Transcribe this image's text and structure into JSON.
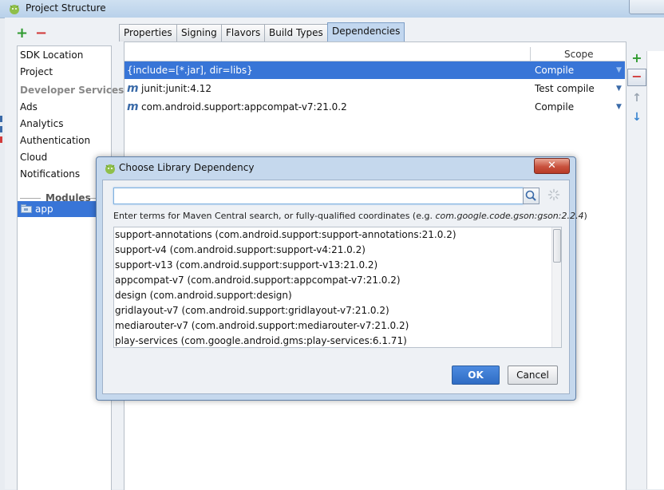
{
  "window": {
    "title": "Project Structure",
    "icon": "android-studio-icon"
  },
  "left_toolbar": {
    "add": "+",
    "remove": "−"
  },
  "sidebar": {
    "items": [
      {
        "label": "SDK Location"
      },
      {
        "label": "Project"
      },
      {
        "label": "Developer Services",
        "kind": "header"
      },
      {
        "label": "Ads"
      },
      {
        "label": "Analytics"
      },
      {
        "label": "Authentication"
      },
      {
        "label": "Cloud"
      },
      {
        "label": "Notifications"
      }
    ],
    "modules_label": "Modules",
    "modules": [
      {
        "label": "app",
        "selected": true
      }
    ]
  },
  "tabs": [
    {
      "label": "Properties"
    },
    {
      "label": "Signing"
    },
    {
      "label": "Flavors"
    },
    {
      "label": "Build Types"
    },
    {
      "label": "Dependencies",
      "active": true
    }
  ],
  "dependencies": {
    "scope_header": "Scope",
    "rows": [
      {
        "name": "{include=[*.jar], dir=libs}",
        "scope": "Compile",
        "selected": true,
        "icon": ""
      },
      {
        "name": "junit:junit:4.12",
        "scope": "Test compile",
        "selected": false,
        "icon": "m"
      },
      {
        "name": "com.android.support:appcompat-v7:21.0.2",
        "scope": "Compile",
        "selected": false,
        "icon": "m"
      }
    ],
    "dropdown_caret": "▼"
  },
  "right_toolbar": {
    "add": "+",
    "remove": "−",
    "up": "↑",
    "down": "↓"
  },
  "dialog": {
    "title": "Choose Library Dependency",
    "close_glyph": "✕",
    "search_value": "",
    "hint_prefix": "Enter terms for Maven Central search, or fully-qualified coordinates (e.g. ",
    "hint_example": "com.google.code.gson:gson:2.2.4",
    "hint_suffix": ")",
    "results": [
      "support-annotations (com.android.support:support-annotations:21.0.2)",
      "support-v4 (com.android.support:support-v4:21.0.2)",
      "support-v13 (com.android.support:support-v13:21.0.2)",
      "appcompat-v7 (com.android.support:appcompat-v7:21.0.2)",
      "design (com.android.support:design)",
      "gridlayout-v7 (com.android.support:gridlayout-v7:21.0.2)",
      "mediarouter-v7 (com.android.support:mediarouter-v7:21.0.2)",
      "play-services (com.google.android.gms:play-services:6.1.71)"
    ],
    "ok_label": "OK",
    "cancel_label": "Cancel"
  },
  "colors": {
    "selection": "#3875d7",
    "add_green": "#2f9a2f",
    "remove_red": "#d23a3a",
    "dialog_frame": "#c5d8ed"
  }
}
